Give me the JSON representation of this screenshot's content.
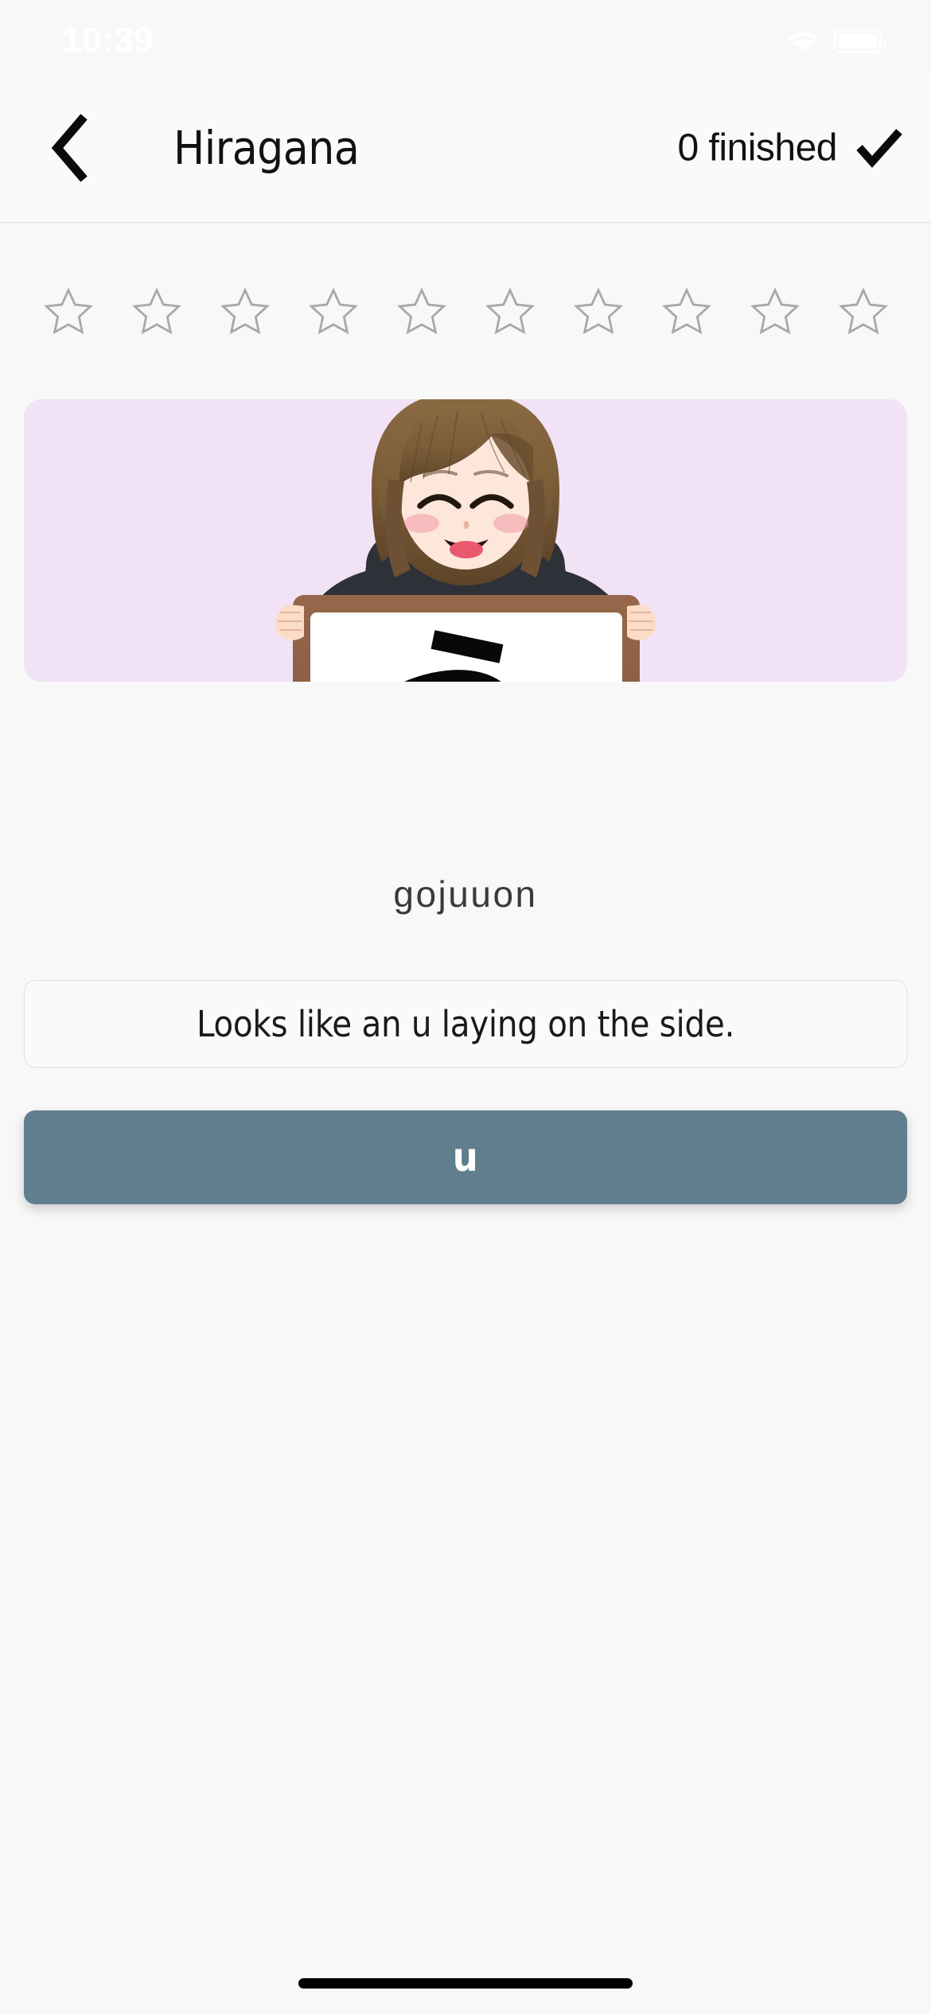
{
  "status_bar": {
    "clock": "10:39",
    "wifi_icon": "wifi-icon",
    "battery_icon": "battery-icon"
  },
  "nav": {
    "back_icon": "chevron-left-icon",
    "title": "Hiragana",
    "finished_label": "0 finished",
    "check_icon": "check-icon"
  },
  "progress": {
    "total_stars": 10,
    "filled_stars": 0,
    "star_icon": "star-outline-icon",
    "star_color": "#A8A8A8"
  },
  "flashcard": {
    "card_background": "#F2E2F5",
    "character": "う",
    "romaji": "u",
    "group_label": "gojuuon",
    "illustration": {
      "name": "anime-girl-holding-whiteboard",
      "hair_color": "#7C5E3B",
      "skin_color": "#FCE4D6",
      "blazer_color": "#2E3138",
      "board_frame_color": "#8B5E3C",
      "board_face_color": "#FFFFFF"
    }
  },
  "hint": {
    "text": "Looks like an u laying on the side."
  },
  "answer_button": {
    "label": "u",
    "background": "#617E8F",
    "text_color": "#FFFFFF"
  },
  "home_indicator": "home-indicator"
}
